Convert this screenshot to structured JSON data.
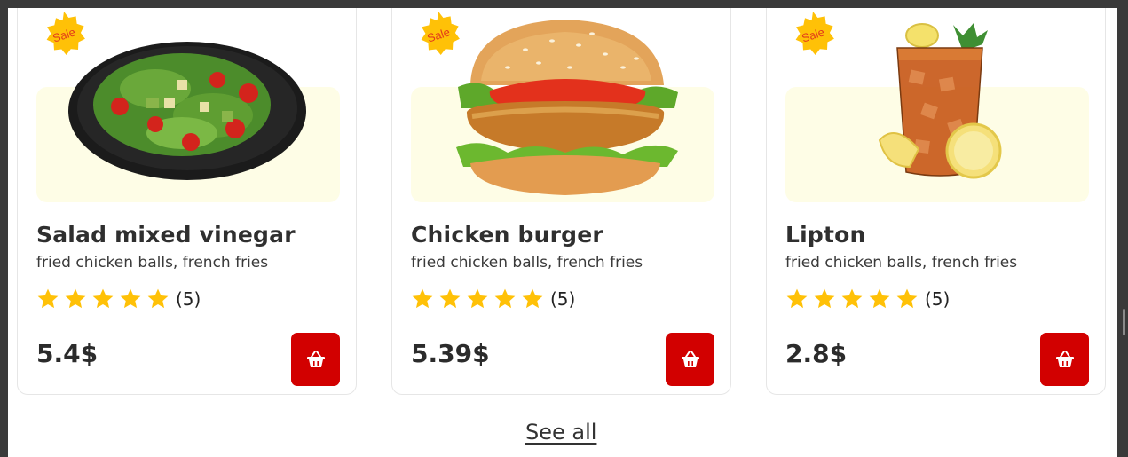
{
  "products": [
    {
      "badge": "Sale",
      "name": "Salad mixed vinegar",
      "description": "fried chicken balls, french fries",
      "rating": 5,
      "rating_count": "(5)",
      "price": "5.4$",
      "image_icon": "salad-icon"
    },
    {
      "badge": "Sale",
      "name": "Chicken burger",
      "description": "fried chicken balls, french fries",
      "rating": 5,
      "rating_count": "(5)",
      "price": "5.39$",
      "image_icon": "burger-icon"
    },
    {
      "badge": "Sale",
      "name": "Lipton",
      "description": "fried chicken balls, french fries",
      "rating": 5,
      "rating_count": "(5)",
      "price": "2.8$",
      "image_icon": "iced-tea-icon"
    }
  ],
  "see_all_label": "See all",
  "colors": {
    "accent": "#d20000",
    "star": "#ffc107",
    "badge": "#ffc107",
    "image_bg": "#fefde6"
  }
}
